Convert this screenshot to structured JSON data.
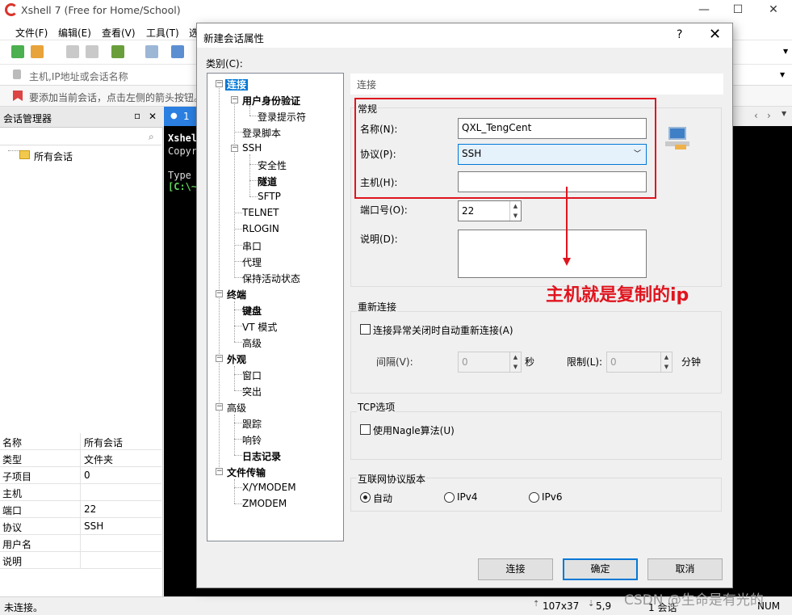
{
  "app": {
    "title": "Xshell 7 (Free for Home/School)",
    "window_controls": [
      "—",
      "☐",
      "✕"
    ]
  },
  "menu": [
    "文件(F)",
    "编辑(E)",
    "查看(V)",
    "工具(T)",
    "选"
  ],
  "addressbar": {
    "placeholder": "主机,IP地址或会话名称"
  },
  "hintbar": {
    "text": "要添加当前会话，点击左侧的箭头按钮。"
  },
  "session_panel": {
    "title": "会话管理器",
    "pin": "ᵖ",
    "close": "✕",
    "tree_root": "所有会话",
    "properties": [
      {
        "key": "名称",
        "value": "所有会话"
      },
      {
        "key": "类型",
        "value": "文件夹"
      },
      {
        "key": "子项目",
        "value": "0"
      },
      {
        "key": "主机",
        "value": ""
      },
      {
        "key": "端口",
        "value": "22"
      },
      {
        "key": "协议",
        "value": "SSH"
      },
      {
        "key": "用户名",
        "value": ""
      },
      {
        "key": "说明",
        "value": ""
      }
    ]
  },
  "terminal": {
    "tab_label": "1",
    "lines": [
      "Xshell",
      "Copyr",
      "",
      "Type",
      "[C:\\~"
    ]
  },
  "statusbar": {
    "left": "未连接。",
    "size": "107x37",
    "pos": "5,9",
    "sessions": "1 会话",
    "num": "NUM"
  },
  "dialog": {
    "title": "新建会话属性",
    "help": "?",
    "close": "✕",
    "category_label": "类别(C):",
    "tree": [
      {
        "label": "连接",
        "level": 0,
        "bold": true,
        "selected": true,
        "toggle": "−"
      },
      {
        "label": "用户身份验证",
        "level": 1,
        "bold": true,
        "toggle": "−"
      },
      {
        "label": "登录提示符",
        "level": 2
      },
      {
        "label": "登录脚本",
        "level": 1
      },
      {
        "label": "SSH",
        "level": 1,
        "toggle": "−"
      },
      {
        "label": "安全性",
        "level": 2
      },
      {
        "label": "隧道",
        "level": 2,
        "bold": true
      },
      {
        "label": "SFTP",
        "level": 2
      },
      {
        "label": "TELNET",
        "level": 1
      },
      {
        "label": "RLOGIN",
        "level": 1
      },
      {
        "label": "串口",
        "level": 1
      },
      {
        "label": "代理",
        "level": 1
      },
      {
        "label": "保持活动状态",
        "level": 1
      },
      {
        "label": "终端",
        "level": 0,
        "bold": true,
        "toggle": "−"
      },
      {
        "label": "键盘",
        "level": 1,
        "bold": true
      },
      {
        "label": "VT 模式",
        "level": 1
      },
      {
        "label": "高级",
        "level": 1
      },
      {
        "label": "外观",
        "level": 0,
        "bold": true,
        "toggle": "−"
      },
      {
        "label": "窗口",
        "level": 1
      },
      {
        "label": "突出",
        "level": 1
      },
      {
        "label": "高级",
        "level": 0,
        "toggle": "−"
      },
      {
        "label": "跟踪",
        "level": 1
      },
      {
        "label": "响铃",
        "level": 1
      },
      {
        "label": "日志记录",
        "level": 1,
        "bold": true
      },
      {
        "label": "文件传输",
        "level": 0,
        "bold": true,
        "toggle": "−"
      },
      {
        "label": "X/YMODEM",
        "level": 1
      },
      {
        "label": "ZMODEM",
        "level": 1
      }
    ],
    "section_title": "连接",
    "general": {
      "group_label": "常规",
      "name_label": "名称(N):",
      "name_value": "QXL_TengCent",
      "protocol_label": "协议(P):",
      "protocol_value": "SSH",
      "host_label": "主机(H):",
      "host_value": "",
      "port_label": "端口号(O):",
      "port_value": "22",
      "desc_label": "说明(D):",
      "desc_value": ""
    },
    "reconnect": {
      "group_label": "重新连接",
      "checkbox_label": "连接异常关闭时自动重新连接(A)",
      "interval_label": "间隔(V):",
      "interval_value": "0",
      "interval_unit": "秒",
      "limit_label": "限制(L):",
      "limit_value": "0",
      "limit_unit": "分钟"
    },
    "tcp": {
      "group_label": "TCP选项",
      "nagle_label": "使用Nagle算法(U)"
    },
    "ip_version": {
      "group_label": "互联网协议版本",
      "options": [
        "自动",
        "IPv4",
        "IPv6"
      ],
      "selected": "自动"
    },
    "buttons": {
      "connect": "连接",
      "ok": "确定",
      "cancel": "取消"
    },
    "annotation": "主机就是复制的ip"
  },
  "watermark": "CSDN @生命是有光的",
  "colors": {
    "accent": "#0078d7",
    "annotation_red": "#e0141e",
    "terminal_bg": "#000000"
  }
}
